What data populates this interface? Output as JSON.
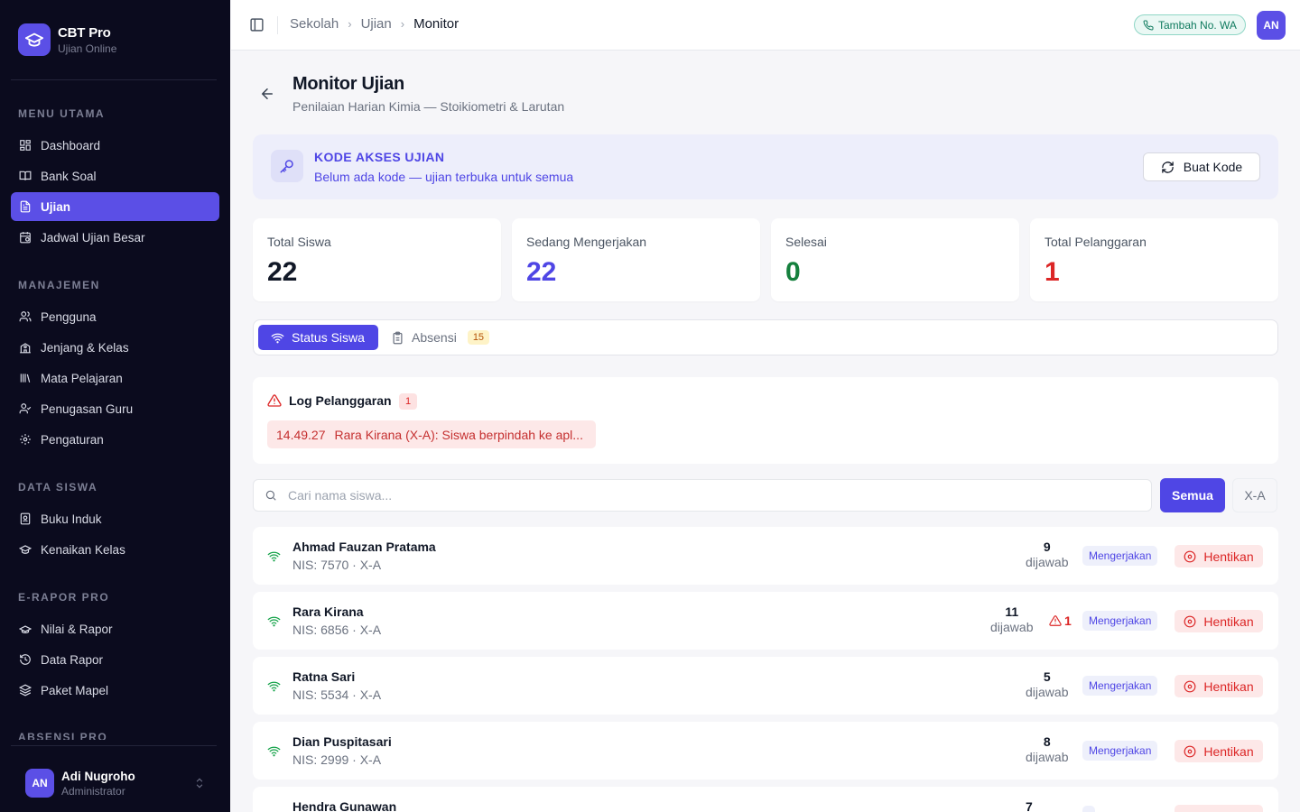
{
  "app": {
    "name": "CBT Pro",
    "tagline": "Ujian Online"
  },
  "sidebar": {
    "sections": [
      {
        "title": "MENU UTAMA",
        "items": [
          {
            "label": "Dashboard",
            "icon": "dashboard-icon"
          },
          {
            "label": "Bank Soal",
            "icon": "book-icon"
          },
          {
            "label": "Ujian",
            "icon": "file-text-icon",
            "active": true
          },
          {
            "label": "Jadwal Ujian Besar",
            "icon": "calendar-icon"
          }
        ]
      },
      {
        "title": "MANAJEMEN",
        "items": [
          {
            "label": "Pengguna",
            "icon": "users-icon"
          },
          {
            "label": "Jenjang & Kelas",
            "icon": "school-icon"
          },
          {
            "label": "Mata Pelajaran",
            "icon": "library-icon"
          },
          {
            "label": "Penugasan Guru",
            "icon": "user-check-icon"
          },
          {
            "label": "Pengaturan",
            "icon": "gear-icon"
          }
        ]
      },
      {
        "title": "DATA SISWA",
        "items": [
          {
            "label": "Buku Induk",
            "icon": "book-contact-icon"
          },
          {
            "label": "Kenaikan Kelas",
            "icon": "graduation-cap-icon"
          }
        ]
      },
      {
        "title": "E-RAPOR PRO",
        "items": [
          {
            "label": "Nilai & Rapor",
            "icon": "award-icon"
          },
          {
            "label": "Data Rapor",
            "icon": "history-icon"
          },
          {
            "label": "Paket Mapel",
            "icon": "layers-icon"
          }
        ]
      },
      {
        "title": "ABSENSI PRO",
        "items": []
      }
    ],
    "user": {
      "initials": "AN",
      "name": "Adi Nugroho",
      "role": "Administrator"
    }
  },
  "header": {
    "breadcrumb": [
      "Sekolah",
      "Ujian",
      "Monitor"
    ],
    "wa_label": "Tambah No. WA",
    "avatar": "AN"
  },
  "page": {
    "title": "Monitor Ujian",
    "subtitle": "Penilaian Harian Kimia — Stoikiometri & Larutan"
  },
  "access": {
    "title": "KODE AKSES UJIAN",
    "desc": "Belum ada kode — ujian terbuka untuk semua",
    "button": "Buat Kode"
  },
  "stats": [
    {
      "label": "Total Siswa",
      "value": "22",
      "color": "#111827"
    },
    {
      "label": "Sedang Mengerjakan",
      "value": "22",
      "color": "#4f46e5"
    },
    {
      "label": "Selesai",
      "value": "0",
      "color": "#15803d"
    },
    {
      "label": "Total Pelanggaran",
      "value": "1",
      "color": "#dc2626"
    }
  ],
  "tabs": {
    "status": "Status Siswa",
    "absensi": "Absensi",
    "absensi_count": "15"
  },
  "log": {
    "title": "Log Pelanggaran",
    "count": "1",
    "entries": [
      {
        "time": "14.49.27",
        "text": "Rara Kirana (X-A): Siswa berpindah ke apl..."
      }
    ]
  },
  "search": {
    "placeholder": "Cari nama siswa..."
  },
  "filters": {
    "all": "Semua",
    "class": "X-A"
  },
  "students": [
    {
      "name": "Ahmad Fauzan Pratama",
      "nis": "NIS: 7570 · X-A",
      "answered": "9",
      "violations": null,
      "status": "Mengerjakan"
    },
    {
      "name": "Rara Kirana",
      "nis": "NIS: 6856 · X-A",
      "answered": "11",
      "violations": "1",
      "status": "Mengerjakan"
    },
    {
      "name": "Ratna Sari",
      "nis": "NIS: 5534 · X-A",
      "answered": "5",
      "violations": null,
      "status": "Mengerjakan"
    },
    {
      "name": "Dian Puspitasari",
      "nis": "NIS: 2999 · X-A",
      "answered": "8",
      "violations": null,
      "status": "Mengerjakan"
    },
    {
      "name": "Hendra Gunawan",
      "nis": "",
      "answered": "7",
      "violations": null,
      "status": "Mengerjakan"
    }
  ],
  "labels": {
    "answered": "dijawab",
    "stop": "Hentikan"
  }
}
